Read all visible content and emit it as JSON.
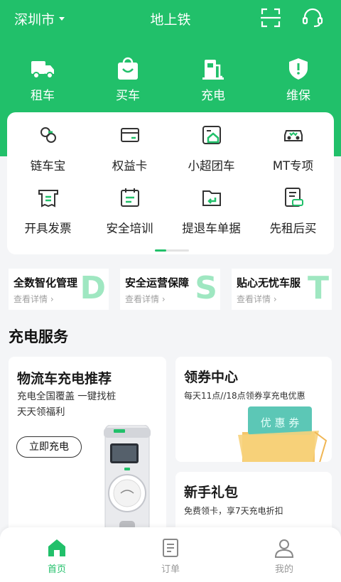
{
  "header": {
    "city": "深圳市",
    "location": "地上铁"
  },
  "top_nav": [
    {
      "label": "租车",
      "icon": "truck-icon"
    },
    {
      "label": "买车",
      "icon": "shopping-bag-icon"
    },
    {
      "label": "充电",
      "icon": "charging-station-icon"
    },
    {
      "label": "维保",
      "icon": "shield-icon"
    }
  ],
  "grid": [
    {
      "label": "链车宝",
      "icon": "link-icon"
    },
    {
      "label": "权益卡",
      "icon": "card-icon"
    },
    {
      "label": "小超团车",
      "icon": "house-screen-icon"
    },
    {
      "label": "MT专项",
      "icon": "vehicle-icon"
    },
    {
      "label": "开具发票",
      "icon": "invoice-icon"
    },
    {
      "label": "安全培训",
      "icon": "calendar-icon"
    },
    {
      "label": "提退车单据",
      "icon": "folder-return-icon"
    },
    {
      "label": "先租后买",
      "icon": "document-car-icon"
    }
  ],
  "banners": [
    {
      "title": "全数智化管理",
      "sub": "查看详情 ›",
      "letter": "D"
    },
    {
      "title": "安全运营保障",
      "sub": "查看详情 ›",
      "letter": "S"
    },
    {
      "title": "贴心无忧车服",
      "sub": "查看详情 ›",
      "letter": "T"
    }
  ],
  "section_title": "充电服务",
  "charge_card": {
    "title": "物流车充电推荐",
    "desc1": "充电全国覆盖 一键找桩",
    "desc2": "天天领福利",
    "button": "立即充电"
  },
  "coupon_card": {
    "title": "领券中心",
    "desc": "每天11点//18点领券享充电优惠",
    "coupon_text": "优 惠 券"
  },
  "gift_card": {
    "title": "新手礼包",
    "desc": "免费领卡，享7天充电折扣"
  },
  "bottom_nav": [
    {
      "label": "首页",
      "icon": "home-icon",
      "active": true
    },
    {
      "label": "订单",
      "icon": "order-icon",
      "active": false
    },
    {
      "label": "我的",
      "icon": "profile-icon",
      "active": false
    }
  ],
  "colors": {
    "accent": "#21c06a",
    "text": "#1a1a1a",
    "muted": "#999999"
  }
}
